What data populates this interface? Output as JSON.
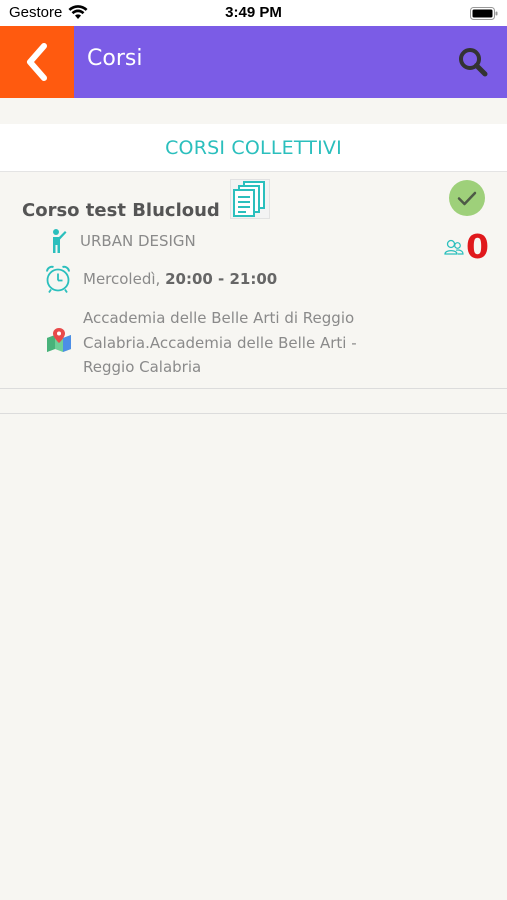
{
  "status_bar": {
    "carrier": "Gestore",
    "time": "3:49 PM"
  },
  "header": {
    "title": "Corsi"
  },
  "section": {
    "label": "CORSI COLLETTIVI"
  },
  "course": {
    "title": "Corso test Blucloud",
    "teacher": "URBAN DESIGN",
    "day": "Mercoledì,",
    "hours": "20:00 - 21:00",
    "location": "Accademia delle Belle Arti di Reggio Calabria.Accademia delle Belle Arti - Reggio Calabria",
    "participants": "0"
  },
  "colors": {
    "header": "#7b5ce6",
    "back": "#ff5a0f",
    "accent": "#2bbfbd",
    "check": "#9ed07a",
    "count": "#e0191c"
  },
  "icons": {
    "back": "chevron-left-icon",
    "search": "search-icon",
    "docs": "documents-icon",
    "check": "check-circle-icon",
    "teacher": "teacher-icon",
    "alarm": "alarm-clock-icon",
    "map": "map-pin-icon",
    "participants": "users-icon"
  }
}
